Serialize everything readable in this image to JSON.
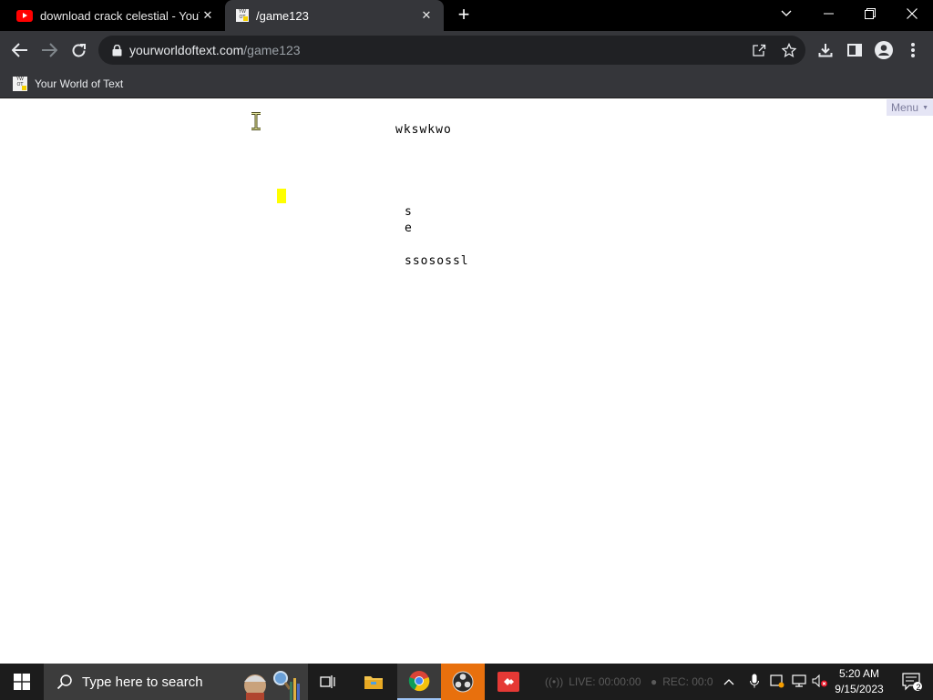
{
  "browser": {
    "tabs": [
      {
        "title": "download crack celestial - YouTube",
        "active": false,
        "favicon": "youtube-icon"
      },
      {
        "title": "/game123",
        "active": true,
        "favicon": "ywot-favicon"
      }
    ],
    "address": {
      "domain": "yourworldoftext.com",
      "path": "/game123"
    },
    "bookmarks": [
      {
        "label": "Your World of Text"
      }
    ],
    "colors": {
      "tabstrip": "#000000",
      "toolbar": "#35363a",
      "omnibox": "#202124"
    }
  },
  "page": {
    "menu_label": "Menu",
    "world_text": [
      {
        "text": "wkswkwo"
      },
      {
        "text": "s"
      },
      {
        "text": "e"
      },
      {
        "text": "ssosossl"
      }
    ],
    "favicon_letters": "YW\nOT",
    "colors": {
      "menu_bg": "#e5e5f5",
      "caret": "#ffff00"
    }
  },
  "taskbar": {
    "search_placeholder": "Type here to search",
    "obs_live": "LIVE: 00:00:00",
    "obs_rec": "REC: 00:0",
    "time": "5:20 AM",
    "date": "9/15/2023",
    "notification_count": "2"
  }
}
